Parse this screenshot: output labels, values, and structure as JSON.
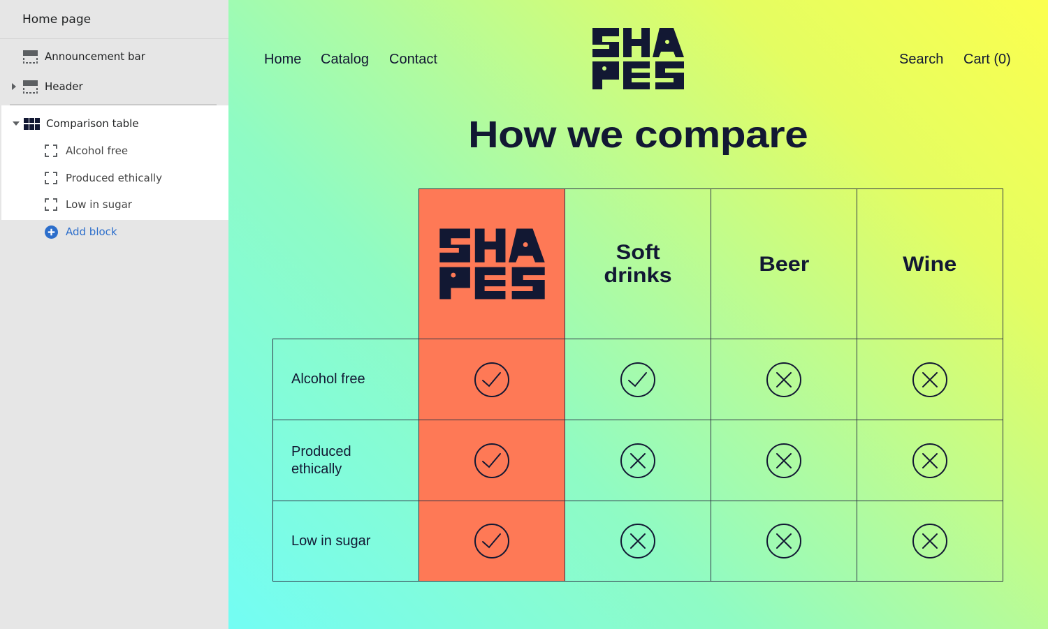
{
  "sidebar": {
    "title": "Home page",
    "items": [
      {
        "label": "Announcement bar",
        "icon": "section-layout-icon",
        "expandable": false
      },
      {
        "label": "Header",
        "icon": "section-layout-icon",
        "expandable": true,
        "expanded": false
      },
      {
        "label": "Comparison table",
        "icon": "shapes-logo-icon",
        "expandable": true,
        "expanded": true,
        "blocks": [
          {
            "label": "Alcohol free",
            "icon": "block-icon"
          },
          {
            "label": "Produced ethically",
            "icon": "block-icon"
          },
          {
            "label": "Low in sugar",
            "icon": "block-icon"
          }
        ]
      },
      {
        "label": "Add block",
        "icon": "plus-circle-icon"
      }
    ]
  },
  "store": {
    "nav_left": [
      "Home",
      "Catalog",
      "Contact"
    ],
    "nav_right": [
      "Search",
      "Cart (0)"
    ],
    "logo_text": [
      "SHA",
      "PES"
    ],
    "heading": "How we compare",
    "table": {
      "columns": [
        {
          "label": "SHAPES",
          "is_logo": true
        },
        {
          "label_lines": [
            "Soft",
            "drinks"
          ]
        },
        {
          "label_lines": [
            "Beer"
          ]
        },
        {
          "label_lines": [
            "Wine"
          ]
        }
      ],
      "rows": [
        {
          "label_lines": [
            "Alcohol free"
          ],
          "values": [
            true,
            true,
            false,
            false
          ]
        },
        {
          "label_lines": [
            "Produced",
            "ethically"
          ],
          "values": [
            true,
            false,
            false,
            false
          ]
        },
        {
          "label_lines": [
            "Low in sugar"
          ],
          "values": [
            true,
            false,
            false,
            false
          ]
        }
      ]
    },
    "colors": {
      "ink": "#121833",
      "brand_column": "#fe7956",
      "gradient_top_right": "#fbff4e",
      "gradient_bottom_left": "#73fdf4",
      "link_blue": "#2c6ecb"
    }
  }
}
